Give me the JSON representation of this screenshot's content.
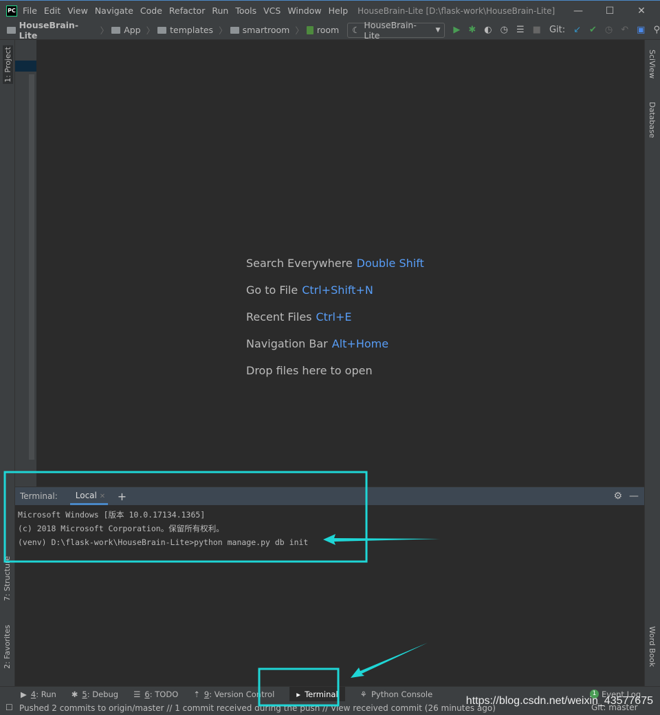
{
  "titlebar": {
    "app_icon": "PC",
    "menu": [
      "File",
      "Edit",
      "View",
      "Navigate",
      "Code",
      "Refactor",
      "Run",
      "Tools",
      "VCS",
      "Window",
      "Help"
    ],
    "title": "HouseBrain-Lite [D:\\flask-work\\HouseBrain-Lite]"
  },
  "navbar": {
    "breadcrumbs": [
      "HouseBrain-Lite",
      "App",
      "templates",
      "smartroom",
      "room"
    ],
    "run_config": "HouseBrain-Lite",
    "git_label": "Git:"
  },
  "left_tabs": {
    "project": "1: Project",
    "structure": "7: Structure",
    "favorites": "2: Favorites"
  },
  "right_tabs": {
    "sciview": "SciView",
    "database": "Database",
    "wordbook": "Word Book"
  },
  "editor_hints": [
    {
      "label": "Search Everywhere",
      "key": "Double Shift"
    },
    {
      "label": "Go to File",
      "key": "Ctrl+Shift+N"
    },
    {
      "label": "Recent Files",
      "key": "Ctrl+E"
    },
    {
      "label": "Navigation Bar",
      "key": "Alt+Home"
    },
    {
      "label": "Drop files here to open",
      "key": ""
    }
  ],
  "terminal": {
    "label": "Terminal:",
    "tab": "Local",
    "lines": [
      "Microsoft Windows [版本 10.0.17134.1365]",
      "(c) 2018 Microsoft Corporation。保留所有权利。",
      "(venv) D:\\flask-work\\HouseBrain-Lite>python manage.py db init"
    ]
  },
  "bottom_tools": [
    {
      "num": "4",
      "label": "Run"
    },
    {
      "num": "5",
      "label": "Debug"
    },
    {
      "num": "6",
      "label": "TODO"
    },
    {
      "num": "9",
      "label": "Version Control"
    },
    {
      "num": "",
      "label": "Terminal"
    },
    {
      "num": "",
      "label": "Python Console"
    }
  ],
  "event_log": {
    "count": "1",
    "label": "Event Log"
  },
  "status": {
    "message": "Pushed 2 commits to origin/master // 1 commit received during the push // View received commit (26 minutes ago)",
    "git": "Git: master"
  },
  "watermark": "https://blog.csdn.net/weixin_43577675",
  "annotation_color": "#1fd6d6"
}
